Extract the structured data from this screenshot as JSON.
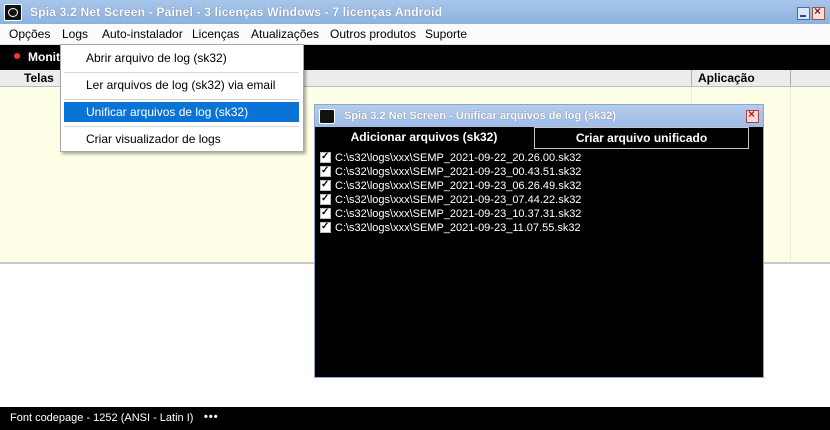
{
  "window": {
    "title": "Spia 3.2 Net Screen   -   Painel   -   3 licenças Windows   -   7 licenças Android"
  },
  "menu": [
    {
      "label": "Opções"
    },
    {
      "label": "Logs"
    },
    {
      "label": "Auto-instalador"
    },
    {
      "label": "Licenças"
    },
    {
      "label": "Atualizações"
    },
    {
      "label": "Outros produtos"
    },
    {
      "label": "Suporte"
    }
  ],
  "toolbar": {
    "monitor_label": "Monit"
  },
  "table": {
    "columns": [
      "Telas",
      "Aplicação"
    ]
  },
  "logs_menu": {
    "items": [
      {
        "label": "Abrir arquivo de log (sk32)"
      },
      {
        "label": "Ler arquivos de log (sk32) via email"
      },
      {
        "label": "Unificar arquivos de log (sk32)"
      },
      {
        "label": "Criar visualizador de logs"
      }
    ]
  },
  "dialog": {
    "title": "Spia 3.2 Net Screen   -   Unificar arquivos de log (sk32)",
    "tab_add": "Adicionar arquivos (sk32)",
    "tab_create": "Criar arquivo unificado",
    "files": [
      {
        "name": "C:\\s32\\logs\\xxx\\SEMP_2021-09-22_20.26.00.sk32",
        "checked": true
      },
      {
        "name": "C:\\s32\\logs\\xxx\\SEMP_2021-09-23_00.43.51.sk32",
        "checked": true
      },
      {
        "name": "C:\\s32\\logs\\xxx\\SEMP_2021-09-23_06.26.49.sk32",
        "checked": true
      },
      {
        "name": "C:\\s32\\logs\\xxx\\SEMP_2021-09-23_07.44.22.sk32",
        "checked": true
      },
      {
        "name": "C:\\s32\\logs\\xxx\\SEMP_2021-09-23_10.37.31.sk32",
        "checked": true
      },
      {
        "name": "C:\\s32\\logs\\xxx\\SEMP_2021-09-23_11.07.55.sk32",
        "checked": true
      }
    ]
  },
  "status": {
    "text": "Font codepage - 1252  (ANSI - Latin I)",
    "dots": "•••"
  },
  "colors": {
    "titlebar": "#99bbe4",
    "menu_highlight": "#0a74d6",
    "grid_background": "#fffee6"
  }
}
